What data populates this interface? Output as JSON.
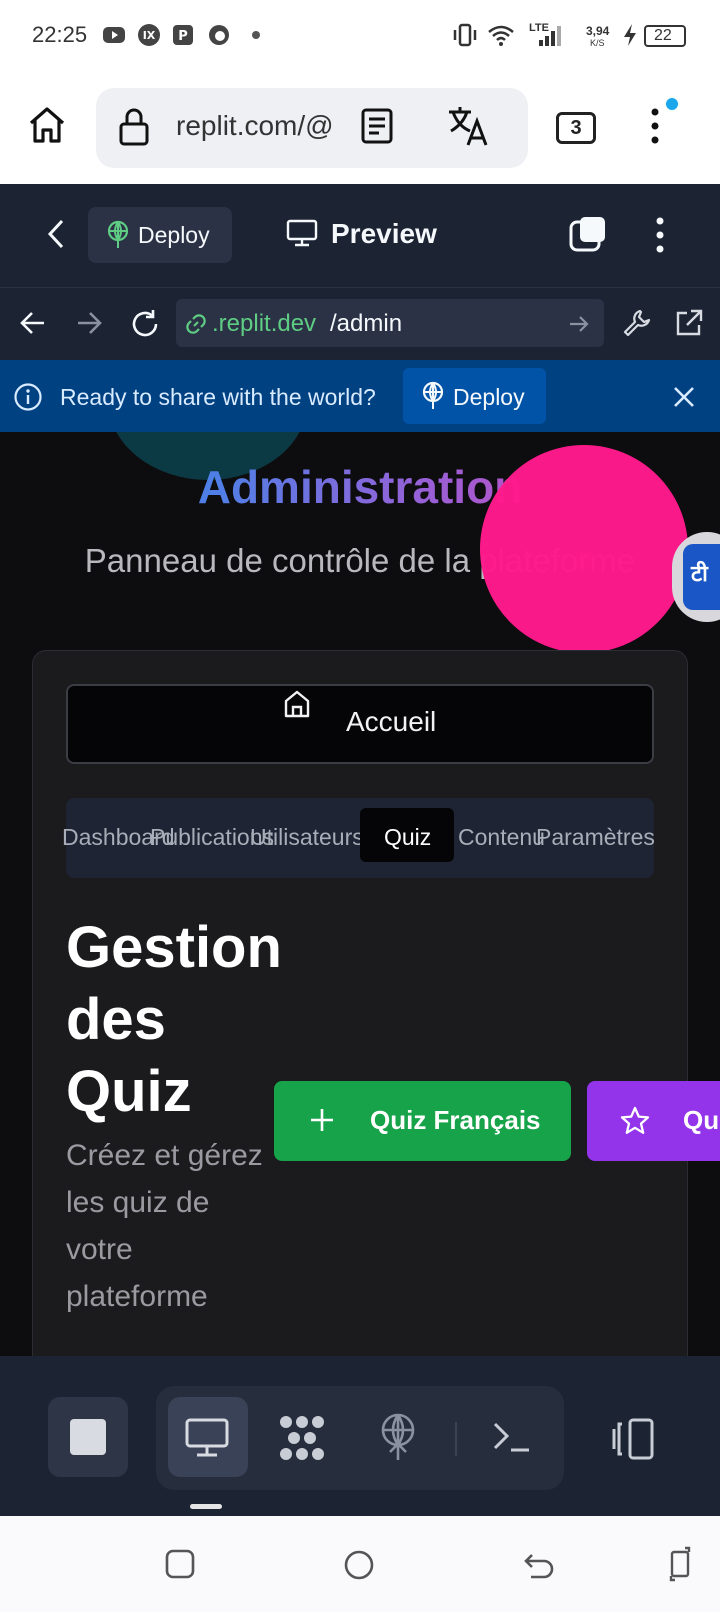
{
  "status_bar": {
    "time": "22:25",
    "net_speed": "3,94",
    "net_unit": "K/S",
    "network": "LTE",
    "battery": "22"
  },
  "browser": {
    "url": "replit.com/@",
    "tab_count": "3"
  },
  "replit": {
    "deploy_label": "Deploy",
    "preview_label": "Preview",
    "webview_domain": ".replit.dev",
    "webview_path": "/admin"
  },
  "banner": {
    "text": "Ready to share with the world?",
    "deploy_label": "Deploy"
  },
  "page": {
    "title": "Administration",
    "subtitle": "Panneau de contrôle de la plateforme",
    "translate_glyph": "टी",
    "home_button": "Accueil",
    "tabs": [
      "Dashboard",
      "Publications",
      "Utilisateurs",
      "Quiz",
      "Contenu",
      "Paramètres"
    ],
    "active_tab": "Quiz",
    "section_title": "Gestion des Quiz",
    "section_desc": "Créez et gérez les quiz de votre plateforme",
    "btn_quiz_fr": "Quiz Français",
    "btn_quiz_2": "Qu"
  },
  "colors": {
    "replit_bg": "#1c2333",
    "banner_bg": "#004182",
    "green_btn": "#16a34a",
    "purple_btn": "#9333ea",
    "pink_overlay": "#ff1a8c"
  }
}
